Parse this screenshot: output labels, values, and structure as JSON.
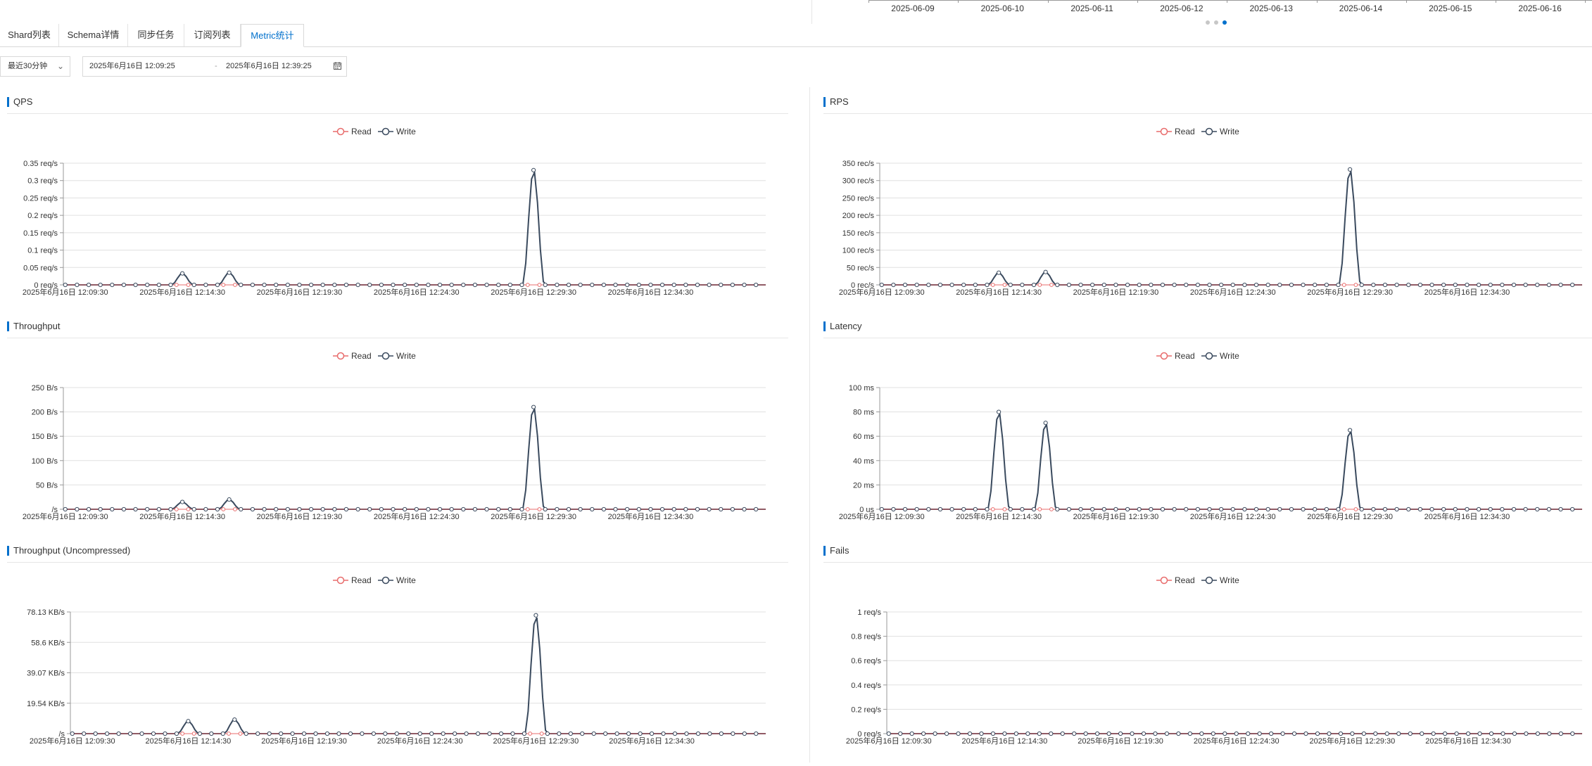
{
  "top_timeline": {
    "dates": [
      "2025-06-09",
      "2025-06-10",
      "2025-06-11",
      "2025-06-12",
      "2025-06-13",
      "2025-06-14",
      "2025-06-15",
      "2025-06-16"
    ],
    "page_dots": 3,
    "active_dot": 2
  },
  "tabs": [
    {
      "label": "Shard列表",
      "active": false
    },
    {
      "label": "Schema详情",
      "active": false
    },
    {
      "label": "同步任务",
      "active": false
    },
    {
      "label": "订阅列表",
      "active": false
    },
    {
      "label": "Metric统计",
      "active": true
    }
  ],
  "time_range": {
    "preset": "最近30分钟",
    "start": "2025年6月16日 12:09:25",
    "separator": "-",
    "end": "2025年6月16日 12:39:25"
  },
  "legend": {
    "read": "Read",
    "write": "Write"
  },
  "colors": {
    "read": "#e86c6c",
    "write": "#3a4a5e",
    "accent": "#0070cc"
  },
  "chart_data": [
    {
      "type": "line",
      "title": "QPS",
      "ytick_labels": [
        "0 req/s",
        "0.05 req/s",
        "0.1 req/s",
        "0.15 req/s",
        "0.2 req/s",
        "0.25 req/s",
        "0.3 req/s",
        "0.35 req/s"
      ],
      "ylim": [
        0,
        0.35
      ],
      "xtick_labels": [
        "2025年6月16日 12:09:30",
        "2025年6月16日 12:14:30",
        "2025年6月16日 12:19:30",
        "2025年6月16日 12:24:30",
        "2025年6月16日 12:29:30",
        "2025年6月16日 12:34:30"
      ],
      "series": [
        {
          "name": "Read",
          "peaks": []
        },
        {
          "name": "Write",
          "peaks": [
            {
              "t": "12:14:30",
              "v": 0.033
            },
            {
              "t": "12:16:30",
              "v": 0.035
            },
            {
              "t": "12:29:30",
              "v": 0.33
            }
          ]
        }
      ]
    },
    {
      "type": "line",
      "title": "RPS",
      "ytick_labels": [
        "0 rec/s",
        "50 rec/s",
        "100 rec/s",
        "150 rec/s",
        "200 rec/s",
        "250 rec/s",
        "300 rec/s",
        "350 rec/s"
      ],
      "ylim": [
        0,
        350
      ],
      "xtick_labels": [
        "2025年6月16日 12:09:30",
        "2025年6月16日 12:14:30",
        "2025年6月16日 12:19:30",
        "2025年6月16日 12:24:30",
        "2025年6月16日 12:29:30",
        "2025年6月16日 12:34:30"
      ],
      "series": [
        {
          "name": "Read",
          "peaks": []
        },
        {
          "name": "Write",
          "peaks": [
            {
              "t": "12:14:30",
              "v": 35
            },
            {
              "t": "12:16:30",
              "v": 37
            },
            {
              "t": "12:29:30",
              "v": 332
            }
          ]
        }
      ]
    },
    {
      "type": "line",
      "title": "Throughput",
      "ytick_labels": [
        "/s",
        "50 B/s",
        "100 B/s",
        "150 B/s",
        "200 B/s",
        "250 B/s"
      ],
      "ylim": [
        0,
        250
      ],
      "xtick_labels": [
        "2025年6月16日 12:09:30",
        "2025年6月16日 12:14:30",
        "2025年6月16日 12:19:30",
        "2025年6月16日 12:24:30",
        "2025年6月16日 12:29:30",
        "2025年6月16日 12:34:30"
      ],
      "series": [
        {
          "name": "Read",
          "peaks": []
        },
        {
          "name": "Write",
          "peaks": [
            {
              "t": "12:14:30",
              "v": 15
            },
            {
              "t": "12:16:30",
              "v": 20
            },
            {
              "t": "12:29:30",
              "v": 210
            }
          ]
        }
      ]
    },
    {
      "type": "line",
      "title": "Latency",
      "ytick_labels": [
        "0 us",
        "20 ms",
        "40 ms",
        "60 ms",
        "80 ms",
        "100 ms"
      ],
      "ylim": [
        0,
        100
      ],
      "xtick_labels": [
        "2025年6月16日 12:09:30",
        "2025年6月16日 12:14:30",
        "2025年6月16日 12:19:30",
        "2025年6月16日 12:24:30",
        "2025年6月16日 12:29:30",
        "2025年6月16日 12:34:30"
      ],
      "series": [
        {
          "name": "Read",
          "peaks": []
        },
        {
          "name": "Write",
          "peaks": [
            {
              "t": "12:14:30",
              "v": 80
            },
            {
              "t": "12:16:30",
              "v": 71
            },
            {
              "t": "12:29:30",
              "v": 65
            }
          ]
        }
      ]
    },
    {
      "type": "line",
      "title": "Throughput (Uncompressed)",
      "ytick_labels": [
        "/s",
        "19.54 KB/s",
        "39.07 KB/s",
        "58.6 KB/s",
        "78.13 KB/s"
      ],
      "ylim": [
        0,
        78.13
      ],
      "xtick_labels": [
        "2025年6月16日 12:09:30",
        "2025年6月16日 12:14:30",
        "2025年6月16日 12:19:30",
        "2025年6月16日 12:24:30",
        "2025年6月16日 12:29:30",
        "2025年6月16日 12:34:30"
      ],
      "series": [
        {
          "name": "Read",
          "peaks": []
        },
        {
          "name": "Write",
          "peaks": [
            {
              "t": "12:14:30",
              "v": 8
            },
            {
              "t": "12:16:30",
              "v": 9
            },
            {
              "t": "12:29:30",
              "v": 76
            }
          ]
        }
      ]
    },
    {
      "type": "line",
      "title": "Fails",
      "ytick_labels": [
        "0 req/s",
        "0.2 req/s",
        "0.4 req/s",
        "0.6 req/s",
        "0.8 req/s",
        "1 req/s"
      ],
      "ylim": [
        0,
        1
      ],
      "xtick_labels": [
        "2025年6月16日 12:09:30",
        "2025年6月16日 12:14:30",
        "2025年6月16日 12:19:30",
        "2025年6月16日 12:24:30",
        "2025年6月16日 12:29:30",
        "2025年6月16日 12:34:30"
      ],
      "series": [
        {
          "name": "Read",
          "peaks": []
        },
        {
          "name": "Write",
          "peaks": []
        }
      ]
    }
  ]
}
